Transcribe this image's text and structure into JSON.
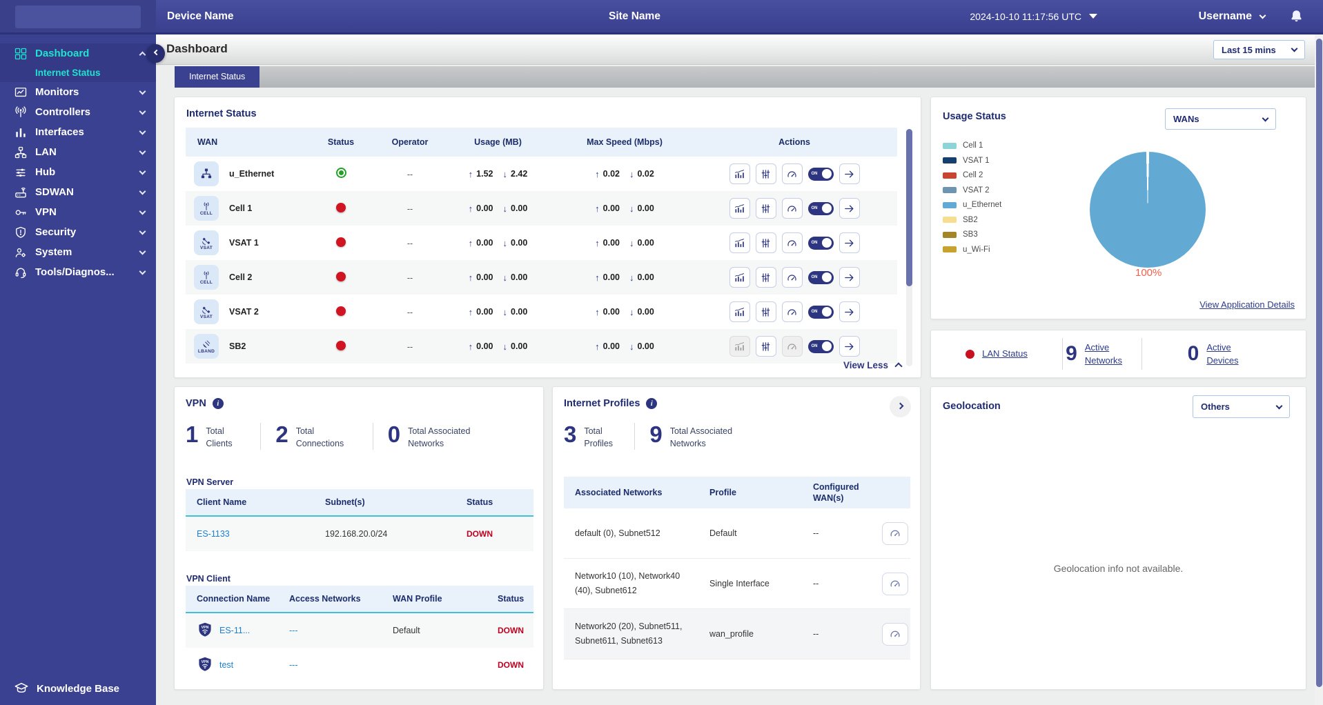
{
  "topbar": {
    "device_name": "Device Name",
    "site_name": "Site Name",
    "datetime": "2024-10-10 11:17:56 UTC",
    "username": "Username"
  },
  "sidebar": {
    "items": [
      {
        "label": "Dashboard",
        "icon": "dashboard-icon",
        "active": true,
        "expanded": true
      },
      {
        "label": "Internet Status",
        "icon": "",
        "submenu": true,
        "active": true
      },
      {
        "label": "Monitors",
        "icon": "monitors-icon"
      },
      {
        "label": "Controllers",
        "icon": "controllers-icon"
      },
      {
        "label": "Interfaces",
        "icon": "interfaces-icon"
      },
      {
        "label": "LAN",
        "icon": "lan-icon"
      },
      {
        "label": "Hub",
        "icon": "hub-icon"
      },
      {
        "label": "SDWAN",
        "icon": "sdwan-icon"
      },
      {
        "label": "VPN",
        "icon": "vpn-key-icon"
      },
      {
        "label": "Security",
        "icon": "security-icon"
      },
      {
        "label": "System",
        "icon": "system-icon"
      },
      {
        "label": "Tools/Diagnos...",
        "icon": "tools-icon"
      }
    ],
    "knowledge_base": "Knowledge Base"
  },
  "page": {
    "title": "Dashboard",
    "time_range": "Last 15 mins",
    "active_tab": "Internet Status"
  },
  "internet_status": {
    "title": "Internet Status",
    "columns": [
      "WAN",
      "Status",
      "Operator",
      "Usage (MB)",
      "Max Speed (Mbps)",
      "Actions"
    ],
    "toggle_label": "ON",
    "view_less": "View Less",
    "rows": [
      {
        "name": "u_Ethernet",
        "icon": "ethernet-icon",
        "icon_label": "",
        "status": "up",
        "operator": "--",
        "usage_up": "1.52",
        "usage_down": "2.42",
        "speed_up": "0.02",
        "speed_down": "0.02",
        "disabled": []
      },
      {
        "name": "Cell 1",
        "icon": "cell-icon",
        "icon_label": "CELL",
        "status": "down",
        "operator": "--",
        "usage_up": "0.00",
        "usage_down": "0.00",
        "speed_up": "0.00",
        "speed_down": "0.00",
        "disabled": []
      },
      {
        "name": "VSAT 1",
        "icon": "vsat-icon",
        "icon_label": "VSAT",
        "status": "down",
        "operator": "--",
        "usage_up": "0.00",
        "usage_down": "0.00",
        "speed_up": "0.00",
        "speed_down": "0.00",
        "disabled": []
      },
      {
        "name": "Cell 2",
        "icon": "cell-icon",
        "icon_label": "CELL",
        "status": "down",
        "operator": "--",
        "usage_up": "0.00",
        "usage_down": "0.00",
        "speed_up": "0.00",
        "speed_down": "0.00",
        "disabled": []
      },
      {
        "name": "VSAT 2",
        "icon": "vsat-icon",
        "icon_label": "VSAT",
        "status": "down",
        "operator": "--",
        "usage_up": "0.00",
        "usage_down": "0.00",
        "speed_up": "0.00",
        "speed_down": "0.00",
        "disabled": []
      },
      {
        "name": "SB2",
        "icon": "lband-icon",
        "icon_label": "LBAND",
        "status": "down",
        "operator": "--",
        "usage_up": "0.00",
        "usage_down": "0.00",
        "speed_up": "0.00",
        "speed_down": "0.00",
        "disabled": [
          "chart",
          "gauge"
        ]
      }
    ]
  },
  "usage_status": {
    "title": "Usage Status",
    "filter_value": "WANs",
    "legend": [
      {
        "label": "Cell 1",
        "color": "#8bd5d9"
      },
      {
        "label": "VSAT 1",
        "color": "#15406e"
      },
      {
        "label": "Cell 2",
        "color": "#c8462f"
      },
      {
        "label": "VSAT 2",
        "color": "#6e95b0"
      },
      {
        "label": "u_Ethernet",
        "color": "#62aad4"
      },
      {
        "label": "SB2",
        "color": "#f7dd8f"
      },
      {
        "label": "SB3",
        "color": "#a3862a"
      },
      {
        "label": "u_Wi-Fi",
        "color": "#c7a22d"
      }
    ],
    "pie_label": "100%",
    "details_link": "View Application Details",
    "chart_data": {
      "type": "pie",
      "categories": [
        "Cell 1",
        "VSAT 1",
        "Cell 2",
        "VSAT 2",
        "u_Ethernet",
        "SB2",
        "SB3",
        "u_Wi-Fi"
      ],
      "values": [
        0,
        0,
        0,
        0,
        100,
        0,
        0,
        0
      ],
      "title": "Usage Status",
      "unit": "%",
      "legend_position": "left"
    }
  },
  "lan_status": {
    "items": [
      {
        "value": "",
        "label": "LAN Status",
        "dot": "#c8101e"
      },
      {
        "value": "9",
        "label": "Active Networks"
      },
      {
        "value": "0",
        "label": "Active Devices"
      }
    ]
  },
  "vpn": {
    "title": "VPN",
    "stats": [
      {
        "value": "1",
        "label": "Total Clients"
      },
      {
        "value": "2",
        "label": "Total Connections"
      },
      {
        "value": "0",
        "label": "Total Associated Networks"
      }
    ],
    "server": {
      "title": "VPN Server",
      "columns": [
        "Client Name",
        "Subnet(s)",
        "Status"
      ],
      "rows": [
        {
          "client": "ES-1133",
          "subnet": "192.168.20.0/24",
          "status": "DOWN"
        }
      ]
    },
    "client": {
      "title": "VPN Client",
      "columns": [
        "Connection Name",
        "Access Networks",
        "WAN Profile",
        "Status"
      ],
      "rows": [
        {
          "name": "ES-11...",
          "networks": "---",
          "profile": "Default",
          "status": "DOWN"
        },
        {
          "name": "test",
          "networks": "---",
          "profile": "",
          "status": "DOWN"
        }
      ]
    }
  },
  "internet_profiles": {
    "title": "Internet Profiles",
    "stats": [
      {
        "value": "3",
        "label": "Total Profiles"
      },
      {
        "value": "9",
        "label": "Total Associated Networks"
      }
    ],
    "columns": [
      "Associated Networks",
      "Profile",
      "Configured WAN(s)",
      ""
    ],
    "rows": [
      {
        "networks": "default (0), Subnet512",
        "profile": "Default",
        "wans": "--"
      },
      {
        "networks": "Network10 (10), Network40 (40), Subnet612",
        "profile": "Single Interface",
        "wans": "--"
      },
      {
        "networks": "Network20 (20), Subnet511, Subnet611, Subnet613",
        "profile": "wan_profile",
        "wans": "--"
      }
    ]
  },
  "geolocation": {
    "title": "Geolocation",
    "filter_value": "Others",
    "empty_text": "Geolocation info not available."
  }
}
